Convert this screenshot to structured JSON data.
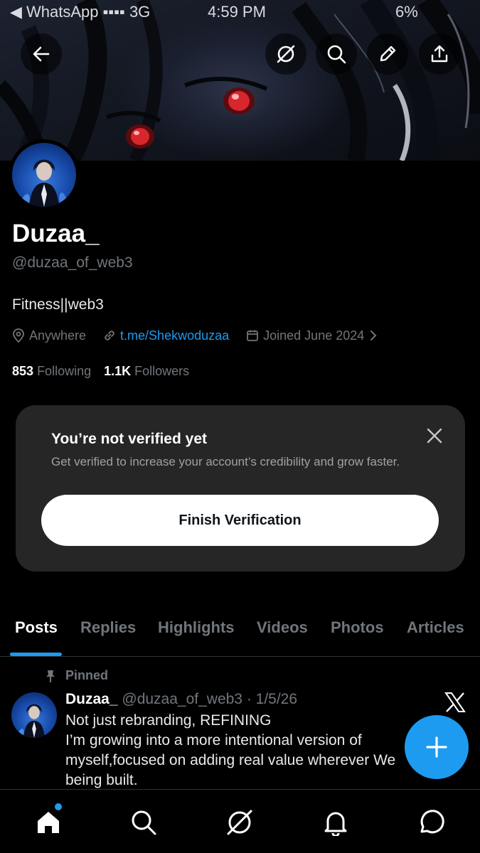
{
  "status_bar": {
    "app": "◀ WhatsApp ▪▪▪▪ 3G",
    "time": "4:59 PM",
    "battery": "6%"
  },
  "header": {
    "icons": [
      "back-arrow-icon",
      "grok-icon",
      "search-icon",
      "edit-pencil-icon",
      "share-upload-icon"
    ]
  },
  "profile": {
    "display_name": "Duzaa_",
    "handle": "@duzaa_of_web3",
    "bio": "Fitness||web3",
    "location": "Anywhere",
    "link": "t.me/Shekwoduzaa",
    "joined": "Joined June 2024",
    "following_count": "853",
    "following_label": "Following",
    "followers_count": "1.1K",
    "followers_label": "Followers"
  },
  "verification_card": {
    "title": "You’re not verified yet",
    "description": "Get verified to increase your account’s credibility and grow faster.",
    "button_label": "Finish Verification"
  },
  "tabs": [
    "Posts",
    "Replies",
    "Highlights",
    "Videos",
    "Photos",
    "Articles"
  ],
  "active_tab": "Posts",
  "pinned_post": {
    "pinned_label": "Pinned",
    "author": "Duzaa_",
    "meta": "@duzaa_of_web3 · 1/5/26",
    "lines": [
      "Not just rebranding, REFINING",
      "I’m growing into a more intentional version of",
      "myself,focused on adding real value wherever We",
      "being built."
    ]
  },
  "bottom_nav": [
    "home-icon",
    "search-icon",
    "grok-icon",
    "notifications-bell-icon",
    "messages-icon"
  ],
  "colors": {
    "accent": "#1d9bf0",
    "background": "#000000",
    "card": "#262626",
    "muted_text": "#71767b"
  }
}
